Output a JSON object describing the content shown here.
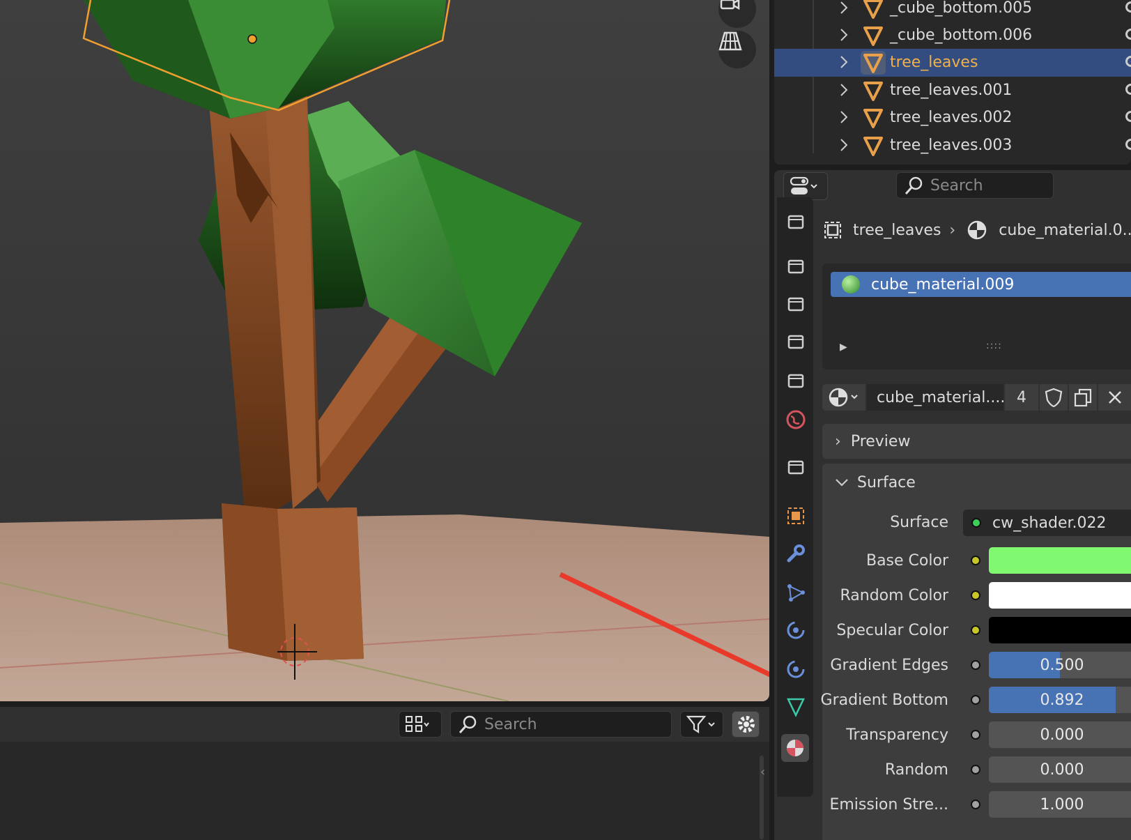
{
  "viewport": {
    "toolbar_icons": [
      "camera-icon",
      "grid-icon"
    ]
  },
  "outliner": {
    "rows": [
      {
        "name": "_cube_bottom.005",
        "selected": false
      },
      {
        "name": "_cube_bottom.006",
        "selected": false
      },
      {
        "name": "tree_leaves",
        "selected": true
      },
      {
        "name": "tree_leaves.001",
        "selected": false
      },
      {
        "name": "tree_leaves.002",
        "selected": false
      },
      {
        "name": "tree_leaves.003",
        "selected": false
      }
    ]
  },
  "bottom_panel": {
    "search_placeholder": "Search"
  },
  "properties": {
    "search_placeholder": "Search",
    "breadcrumb": {
      "object": "tree_leaves",
      "material": "cube_material.0..."
    },
    "material_slot": "cube_material.009",
    "material_selector": {
      "name": "cube_material....",
      "users": "4"
    },
    "preview_label": "Preview",
    "surface_panel_label": "Surface",
    "surface": {
      "label": "Surface",
      "shader": "cw_shader.022"
    },
    "inputs": [
      {
        "label": "Base Color",
        "type": "color",
        "color": "#80f870",
        "socket": "#c7c729"
      },
      {
        "label": "Random Color",
        "type": "color",
        "color": "#ffffff",
        "socket": "#c7c729"
      },
      {
        "label": "Specular Color",
        "type": "color",
        "color": "#000000",
        "socket": "#c7c729"
      },
      {
        "label": "Gradient Edges",
        "type": "value",
        "value": "0.500",
        "fraction": 0.5,
        "socket": "#a1a1a1"
      },
      {
        "label": "Gradient Bottom",
        "type": "value",
        "value": "0.892",
        "fraction": 0.892,
        "socket": "#a1a1a1"
      },
      {
        "label": "Transparency",
        "type": "value",
        "value": "0.000",
        "fraction": 0,
        "socket": "#a1a1a1"
      },
      {
        "label": "Random",
        "type": "value",
        "value": "0.000",
        "fraction": 0,
        "socket": "#a1a1a1"
      },
      {
        "label": "Emission Stre...",
        "type": "value",
        "value": "1.000",
        "fraction": 0,
        "socket": "#a1a1a1"
      }
    ],
    "tabs": [
      "tool-icon",
      "render-icon",
      "output-icon",
      "view-layer-icon",
      "scene-icon",
      "world-icon",
      "collection-icon",
      "object-icon",
      "modifier-icon",
      "particles-icon",
      "physics-icon",
      "constraints-icon",
      "data-icon",
      "material-icon"
    ]
  },
  "colors": {
    "selection_blue": "#4772b3",
    "outliner_selected_row": "#334d80",
    "annotation_arrow": "#e8392b",
    "object_orange": "#e8a04a",
    "mesh_teal": "#3cc9a8"
  }
}
